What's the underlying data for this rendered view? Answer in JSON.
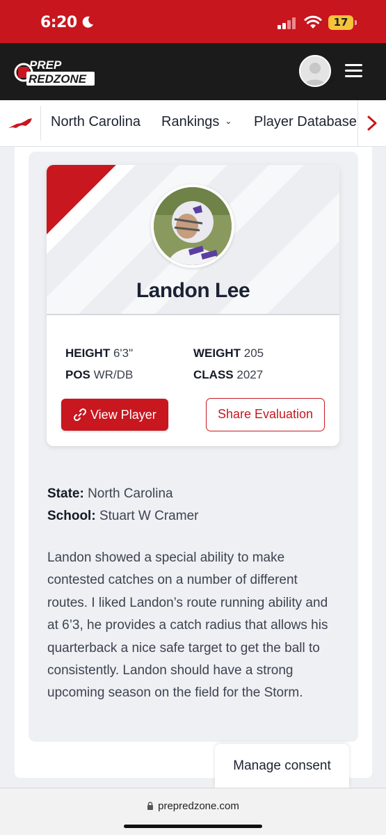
{
  "status_bar": {
    "time": "6:20",
    "battery": "17",
    "colors": {
      "background": "#c8161e",
      "battery": "#f6c33a"
    }
  },
  "header": {
    "logo_line1": "PREP",
    "logo_line2": "REDZONE",
    "icons": [
      "avatar-icon",
      "hamburger-menu-icon"
    ],
    "background": "#1b1b1b"
  },
  "nav": {
    "state_icon": "north-carolina-map-icon",
    "items": [
      "North Carolina",
      "Rankings",
      "Player Database"
    ],
    "rankings_dropdown_icon": "chevron-down-icon",
    "next_icon": "chevron-right-icon"
  },
  "player": {
    "name": "Landon Lee",
    "stats": {
      "height_label": "HEIGHT",
      "height_value": "6'3\"",
      "weight_label": "WEIGHT",
      "weight_value": "205",
      "pos_label": "POS",
      "pos_value": "WR/DB",
      "class_label": "CLASS",
      "class_value": "2027"
    },
    "view_button": "View Player",
    "share_button": "Share Evaluation"
  },
  "evaluation": {
    "state_label": "State:",
    "state_value": "North Carolina",
    "school_label": "School:",
    "school_value": "Stuart W Cramer",
    "text": "Landon showed a special ability to make contested catches on a number of different routes. I liked Landon’s route running ability and at 6’3, he provides a catch radius that allows his quarterback a nice safe target to get the ball to consistently. Landon should have a strong upcoming season on the field for the Storm."
  },
  "consent_button": "Manage consent",
  "browser": {
    "url": "prepredzone.com"
  },
  "brand_colors": {
    "red": "#c8171f",
    "dark": "#1b2235"
  }
}
